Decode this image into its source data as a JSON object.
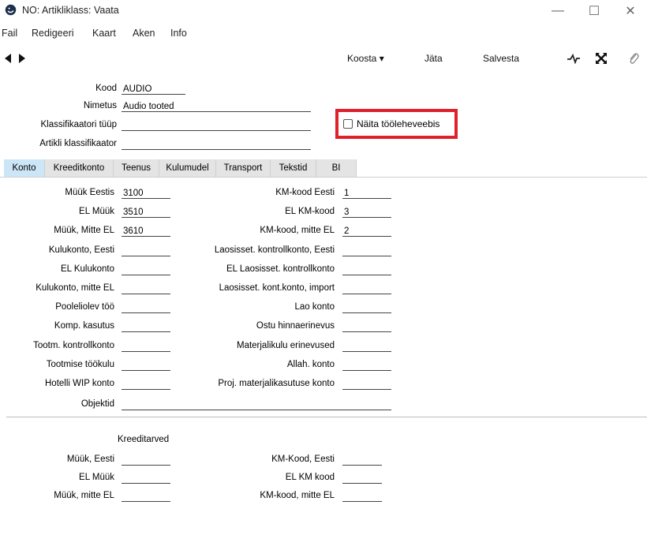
{
  "window": {
    "title": "NO: Artikliklass: Vaata",
    "controls": [
      "—",
      "☐",
      "✕"
    ]
  },
  "menu": [
    "Fail",
    "Redigeeri",
    "Kaart",
    "Aken",
    "Info"
  ],
  "toolbar": {
    "create_label": "Koosta ▾",
    "cancel_label": "Jäta",
    "save_label": "Salvesta"
  },
  "header": {
    "kood_label": "Kood",
    "kood_value": "AUDIO",
    "nimetus_label": "Nimetus",
    "nimetus_value": "Audio tooted",
    "klass_type_label": "Klassifikaatori tüüp",
    "klass_type_value": "",
    "art_klass_label": "Artikli klassifikaator",
    "art_klass_value": "",
    "web_checkbox_label": "Näita tööleheveebis",
    "web_checkbox_checked": false,
    "highlight_color": "#e0202a"
  },
  "tabs": [
    "Konto",
    "Kreeditkonto",
    "Teenus",
    "Kulumudel",
    "Transport",
    "Tekstid",
    "BI"
  ],
  "active_tab": 0,
  "accounts_left": [
    {
      "label": "Müük Eestis",
      "value": "3100"
    },
    {
      "label": "EL Müük",
      "value": "3510"
    },
    {
      "label": "Müük, Mitte EL",
      "value": "3610"
    },
    {
      "label": "Kulukonto, Eesti",
      "value": ""
    },
    {
      "label": "EL Kulukonto",
      "value": ""
    },
    {
      "label": "Kulukonto, mitte EL",
      "value": ""
    },
    {
      "label": "Pooleliolev töö",
      "value": ""
    },
    {
      "label": "Komp. kasutus",
      "value": ""
    },
    {
      "label": "Tootm. kontrollkonto",
      "value": ""
    },
    {
      "label": "Tootmise töökulu",
      "value": ""
    },
    {
      "label": "Hotelli WIP konto",
      "value": ""
    }
  ],
  "accounts_right": [
    {
      "label": "KM-kood Eesti",
      "value": "1"
    },
    {
      "label": "EL  KM-kood",
      "value": "3"
    },
    {
      "label": "KM-kood, mitte EL",
      "value": "2"
    },
    {
      "label": "Laosisset. kontrollkonto, Eesti",
      "value": ""
    },
    {
      "label": "EL Laosisset. kontrollkonto",
      "value": ""
    },
    {
      "label": "Laosisset. kont.konto, import",
      "value": ""
    },
    {
      "label": "Lao konto",
      "value": ""
    },
    {
      "label": "Ostu hinnaerinevus",
      "value": ""
    },
    {
      "label": "Materjalikulu erinevused",
      "value": ""
    },
    {
      "label": "Allah. konto",
      "value": ""
    },
    {
      "label": "Proj. materjalikasutuse konto",
      "value": ""
    }
  ],
  "objektid_label": "Objektid",
  "objektid_value": "",
  "credit": {
    "heading": "Kreeditarved",
    "left": [
      {
        "label": "Müük, Eesti",
        "value": ""
      },
      {
        "label": "EL Müük",
        "value": ""
      },
      {
        "label": "Müük, mitte EL",
        "value": ""
      }
    ],
    "right": [
      {
        "label": "KM-Kood, Eesti",
        "value": ""
      },
      {
        "label": "EL KM kood",
        "value": ""
      },
      {
        "label": "KM-kood, mitte EL",
        "value": ""
      }
    ]
  }
}
